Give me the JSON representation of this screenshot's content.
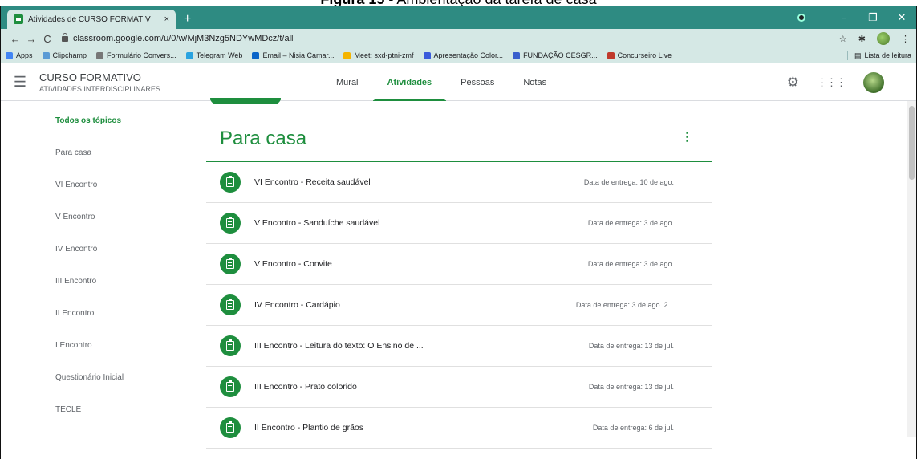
{
  "caption": {
    "bold": "Figura 15",
    "rest": " - Ambientação da tarefa de casa"
  },
  "browser": {
    "tab_title": "Atividades de CURSO FORMATIV",
    "tab_close": "×",
    "new_tab": "+",
    "win_min": "−",
    "win_max": "❐",
    "win_close": "✕",
    "back": "←",
    "forward": "→",
    "reload": "C",
    "url": "classroom.google.com/u/0/w/MjM3Nzg5NDYwMDcz/t/all",
    "star": "☆",
    "more": "⋮",
    "bookmarks": [
      {
        "label": "Apps",
        "color": "#4285f4"
      },
      {
        "label": "Clipchamp",
        "color": "#5b9bd5"
      },
      {
        "label": "Formulário Convers...",
        "color": "#777777"
      },
      {
        "label": "Telegram Web",
        "color": "#2aa3e0"
      },
      {
        "label": "Email – Nisia Camar...",
        "color": "#0a64c8"
      },
      {
        "label": "Meet: sxd-ptni-zmf",
        "color": "#f4b400"
      },
      {
        "label": "Apresentação Color...",
        "color": "#3b5bdb"
      },
      {
        "label": "FUNDAÇÃO CESGR...",
        "color": "#3a5fcd"
      },
      {
        "label": "Concurseiro Live",
        "color": "#c0392b"
      }
    ],
    "reading_list": "Lista de leitura"
  },
  "header": {
    "menu_icon": "☰",
    "course_name": "CURSO FORMATIVO",
    "course_sub": "ATIVIDADES INTERDISCIPLINARES",
    "tabs": [
      {
        "label": "Mural",
        "active": false
      },
      {
        "label": "Atividades",
        "active": true
      },
      {
        "label": "Pessoas",
        "active": false
      },
      {
        "label": "Notas",
        "active": false
      }
    ],
    "settings_icon": "⚙",
    "apps_icon": "⋮⋮⋮"
  },
  "sidebar": {
    "topics": [
      "Todos os tópicos",
      "Para casa",
      "VI Encontro",
      "V Encontro",
      "IV Encontro",
      "III Encontro",
      "II Encontro",
      "I Encontro",
      "Questionário Inicial",
      "TECLE"
    ]
  },
  "section": {
    "title": "Para casa",
    "menu": "⋮",
    "items": [
      {
        "title": "VI Encontro - Receita saudável",
        "due": "Data de entrega: 10 de ago."
      },
      {
        "title": "V Encontro - Sanduíche saudável",
        "due": "Data de entrega: 3 de ago."
      },
      {
        "title": "V Encontro - Convite",
        "due": "Data de entrega: 3 de ago."
      },
      {
        "title": "IV Encontro - Cardápio",
        "due": "Data de entrega: 3 de ago. 2..."
      },
      {
        "title": "III Encontro - Leitura do texto: O Ensino de ...",
        "due": "Data de entrega: 13 de jul."
      },
      {
        "title": "III Encontro - Prato colorido",
        "due": "Data de entrega: 13 de jul."
      },
      {
        "title": "II Encontro - Plantio de grãos",
        "due": "Data de entrega: 6 de jul."
      }
    ]
  },
  "colors": {
    "accent": "#1e8e3e",
    "chrome": "#2e8b82",
    "toolbar": "#d5e8e5"
  }
}
